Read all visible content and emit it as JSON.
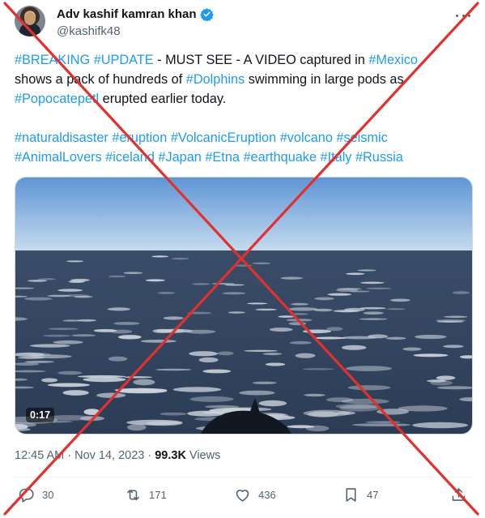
{
  "author": {
    "display_name": "Adv kashif kamran khan",
    "handle": "@kashifk48",
    "verified": true
  },
  "tweet": {
    "lines": [
      [
        {
          "text": "#BREAKING",
          "hashtag": true
        },
        {
          "text": " ",
          "hashtag": false
        },
        {
          "text": "#UPDATE",
          "hashtag": true
        },
        {
          "text": " - MUST SEE - A VIDEO captured in ",
          "hashtag": false
        },
        {
          "text": "#Mexico",
          "hashtag": true
        }
      ],
      [
        {
          "text": "shows a pack of hundreds of ",
          "hashtag": false
        },
        {
          "text": "#Dolphins",
          "hashtag": true
        },
        {
          "text": " swimming in large pods as",
          "hashtag": false
        }
      ],
      [
        {
          "text": "#Popocatepetl",
          "hashtag": true
        },
        {
          "text": " erupted earlier today.",
          "hashtag": false
        }
      ]
    ],
    "hashtag_lines": [
      [
        "#naturaldisaster",
        "#eruption",
        "#VolcanicEruption",
        "#volcano",
        "#seismic"
      ],
      [
        "#AnimalLovers",
        "#iceland",
        "#Japan",
        "#Etna",
        "#earthquake",
        "#Italy",
        "#Russia"
      ]
    ]
  },
  "media": {
    "duration": "0:17",
    "colors": {
      "sky_top": "#5f95d6",
      "sky_bottom": "#c7dcef",
      "sea": "#2c3c55",
      "foam": "#e9eef3"
    }
  },
  "meta": {
    "time": "12:45 AM",
    "separator": "·",
    "date": "Nov 14, 2023",
    "separator2": "·",
    "views_count": "99.3K",
    "views_label": "Views"
  },
  "actions": {
    "replies": "30",
    "reposts": "171",
    "likes": "436",
    "bookmarks": "47"
  },
  "colors": {
    "accent": "#1d9bf0",
    "cross": "#e0312f",
    "muted": "#536471"
  }
}
